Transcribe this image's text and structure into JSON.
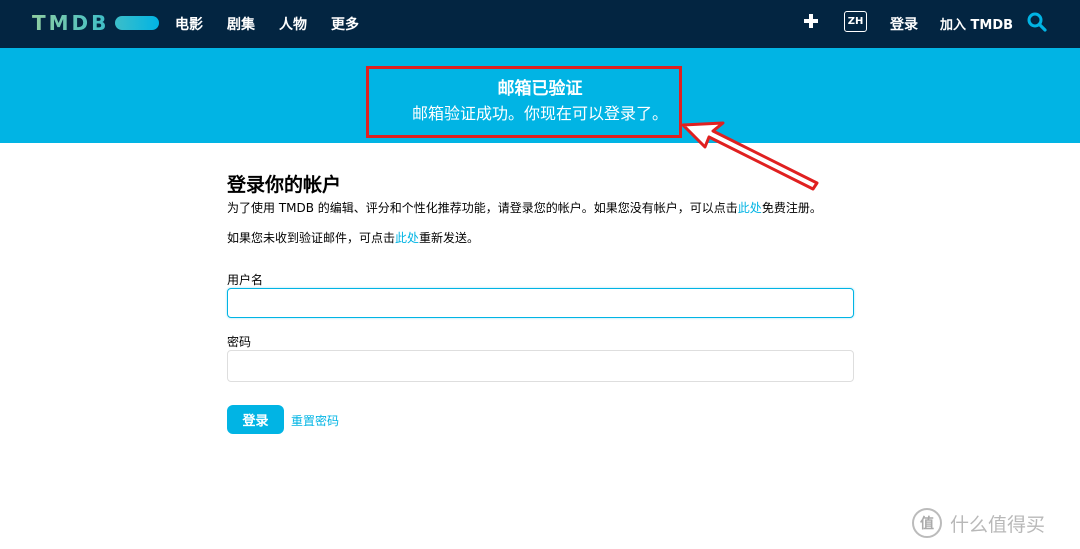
{
  "header": {
    "logo_text": "TMDB",
    "nav": [
      "电影",
      "剧集",
      "人物",
      "更多"
    ],
    "lang": "ZH",
    "login": "登录",
    "join": "加入 TMDB"
  },
  "banner": {
    "title": "邮箱已验证",
    "message": "邮箱验证成功。你现在可以登录了。"
  },
  "main": {
    "title": "登录你的帐户",
    "desc_before": "为了使用 TMDB 的编辑、评分和个性化推荐功能，请登录您的帐户。如果您没有帐户，可以点击",
    "desc_link": "此处",
    "desc_after": "免费注册。",
    "resend_before": "如果您未收到验证邮件，可点击",
    "resend_link": "此处",
    "resend_after": "重新发送。",
    "username_label": "用户名",
    "username_value": "",
    "password_label": "密码",
    "password_value": "",
    "login_button": "登录",
    "reset_link": "重置密码"
  },
  "watermark": {
    "symbol": "值",
    "text": "什么值得买"
  },
  "colors": {
    "header_bg": "#032541",
    "accent": "#01b4e4",
    "highlight": "#e02020"
  }
}
